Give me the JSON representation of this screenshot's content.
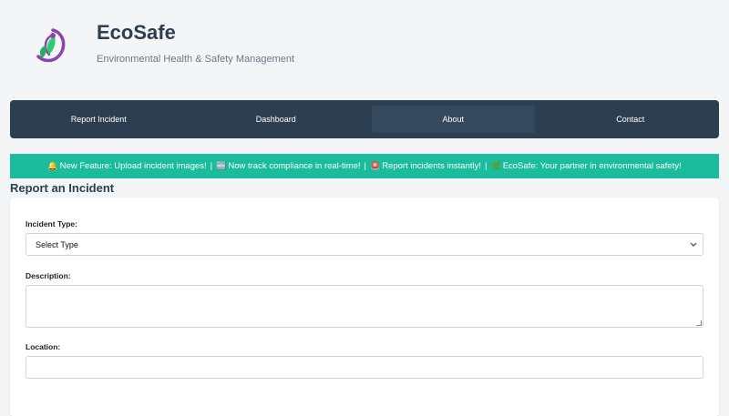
{
  "brand": {
    "title": "EcoSafe",
    "subtitle": "Environmental Health & Safety Management",
    "logo_icon": "eco-leaf-logo-icon",
    "colors": {
      "purple": "#8e44ad",
      "green": "#2ecc71"
    }
  },
  "nav": {
    "items": [
      {
        "label": "Report Incident",
        "active": false
      },
      {
        "label": "Dashboard",
        "active": false
      },
      {
        "label": "About",
        "active": true
      },
      {
        "label": "Contact",
        "active": false
      }
    ],
    "background": "#2c3e50"
  },
  "ticker": {
    "background": "#1abc9c",
    "items": [
      {
        "icon": "🔔",
        "text": "New Feature: Upload incident images!"
      },
      {
        "icon": "🆕",
        "text": "Now track compliance in real-time!"
      },
      {
        "icon": "🚨",
        "text": "Report incidents instantly!"
      },
      {
        "icon": "🌿",
        "text": "EcoSafe: Your partner in environmental safety!"
      }
    ],
    "separator": "|"
  },
  "form": {
    "title": "Report an Incident",
    "incident_type_label": "Incident Type:",
    "incident_type_value": "Select Type",
    "description_label": "Description:",
    "description_value": "",
    "location_label": "Location:",
    "location_value": ""
  }
}
